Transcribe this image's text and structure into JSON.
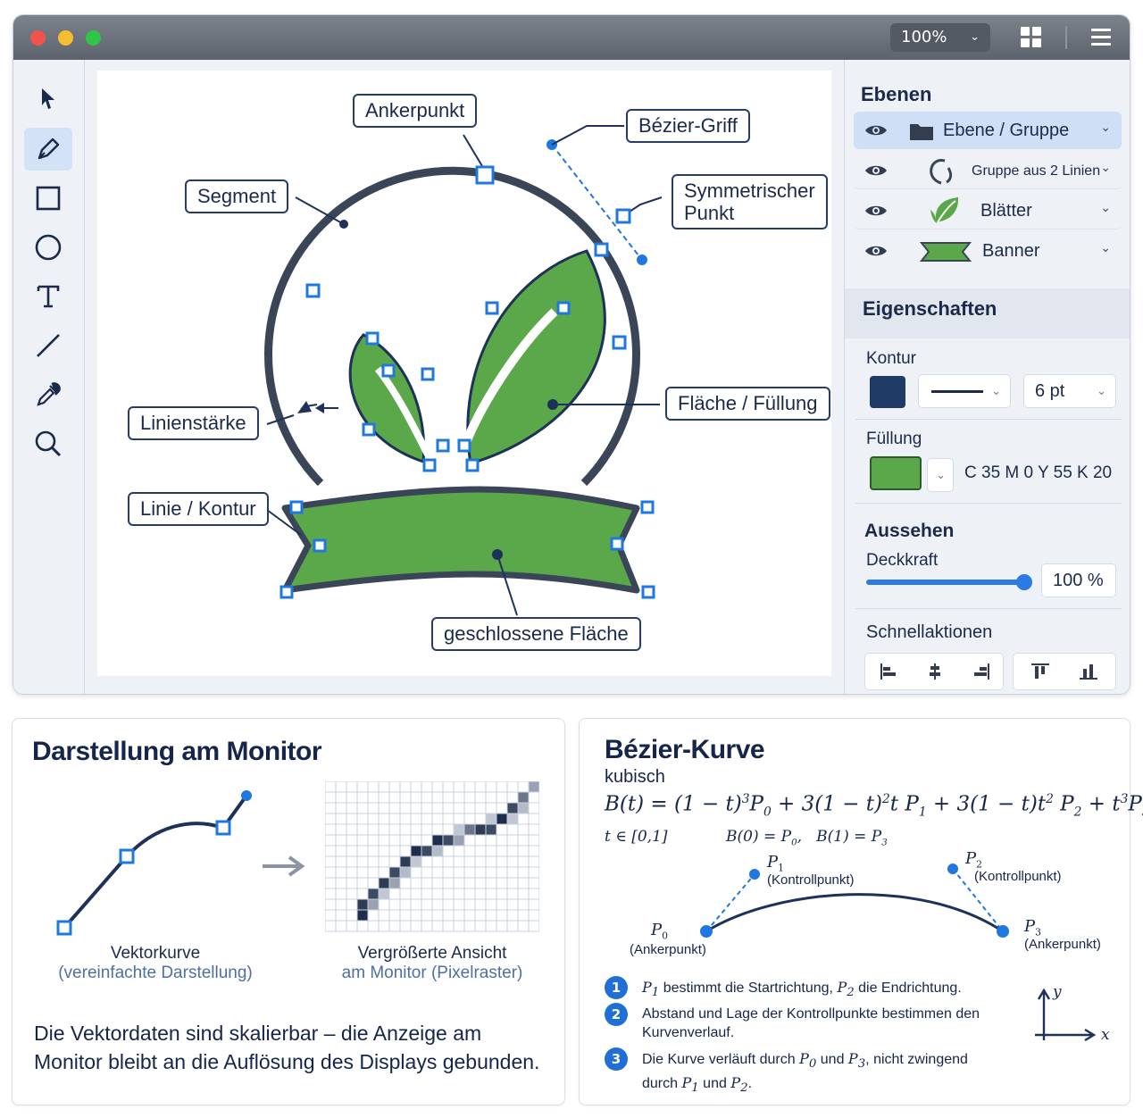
{
  "window": {
    "zoom": "100%",
    "tools": [
      "select-tool",
      "pen-tool",
      "rectangle-tool",
      "ellipse-tool",
      "text-tool",
      "line-tool",
      "eyedropper-tool",
      "zoom-tool"
    ],
    "active_tool": "pen-tool"
  },
  "canvas": {
    "callouts": {
      "anchor": "Ankerpunkt",
      "bezier_handle": "Bézier-Griff",
      "segment": "Segment",
      "symmetric_point_1": "Symmetrischer",
      "symmetric_point_2": "Punkt",
      "stroke_width": "Linienstärke",
      "fill": "Fläche / Füllung",
      "stroke": "Linie / Kontur",
      "closed_area": "geschlossene Fläche"
    },
    "colors": {
      "stroke": "#3a4558",
      "fill": "#5aa84a",
      "anchor": "#1f78e0"
    }
  },
  "layers": {
    "title": "Ebenen",
    "items": [
      {
        "label": "Ebene / Gruppe",
        "icon": "folder-icon"
      },
      {
        "label": "Gruppe aus 2 Linien",
        "icon": "curve-icon"
      },
      {
        "label": "Blätter",
        "icon": "leaf-icon"
      },
      {
        "label": "Banner",
        "icon": "banner-icon"
      }
    ]
  },
  "properties": {
    "title": "Eigenschaften",
    "stroke_label": "Kontur",
    "stroke_color": "#203a66",
    "stroke_width": "6 pt",
    "fill_label": "Füllung",
    "fill_color": "#5aa84a",
    "fill_value": "C 35  M 0  Y 55  K 20",
    "appearance_title": "Aussehen",
    "opacity_label": "Deckkraft",
    "opacity_value": "100 %",
    "opacity_fraction": 1.0,
    "quick_actions_title": "Schnellaktionen",
    "quick_actions": [
      "align-left-icon",
      "align-center-icon",
      "align-right-icon",
      "align-top-icon",
      "align-bottom-icon"
    ]
  },
  "monitor_card": {
    "title": "Darstellung am Monitor",
    "vector_caption_1": "Vektorkurve",
    "vector_caption_2": "(vereinfachte Darstellung)",
    "pixel_caption_1": "Vergrößerte Ansicht",
    "pixel_caption_2": "am Monitor (Pixelraster)",
    "note": "Die Vektordaten sind skalierbar – die Anzeige am Monitor bleibt an die Auflösung des Displays gebunden."
  },
  "bezier_card": {
    "title": "Bézier-Kurve",
    "subtitle": "kubisch",
    "p1_label": "(Kontrollpunkt)",
    "p2_label": "(Kontrollpunkt)",
    "p0_label": "(Ankerpunkt)",
    "p3_label": "(Ankerpunkt)",
    "steps": [
      "1",
      "2",
      "3"
    ],
    "step2": "Abstand und Lage der Kontrollpunkte bestimmen den Kurvenverlauf.",
    "axis_y": "y",
    "axis_x": "x"
  }
}
